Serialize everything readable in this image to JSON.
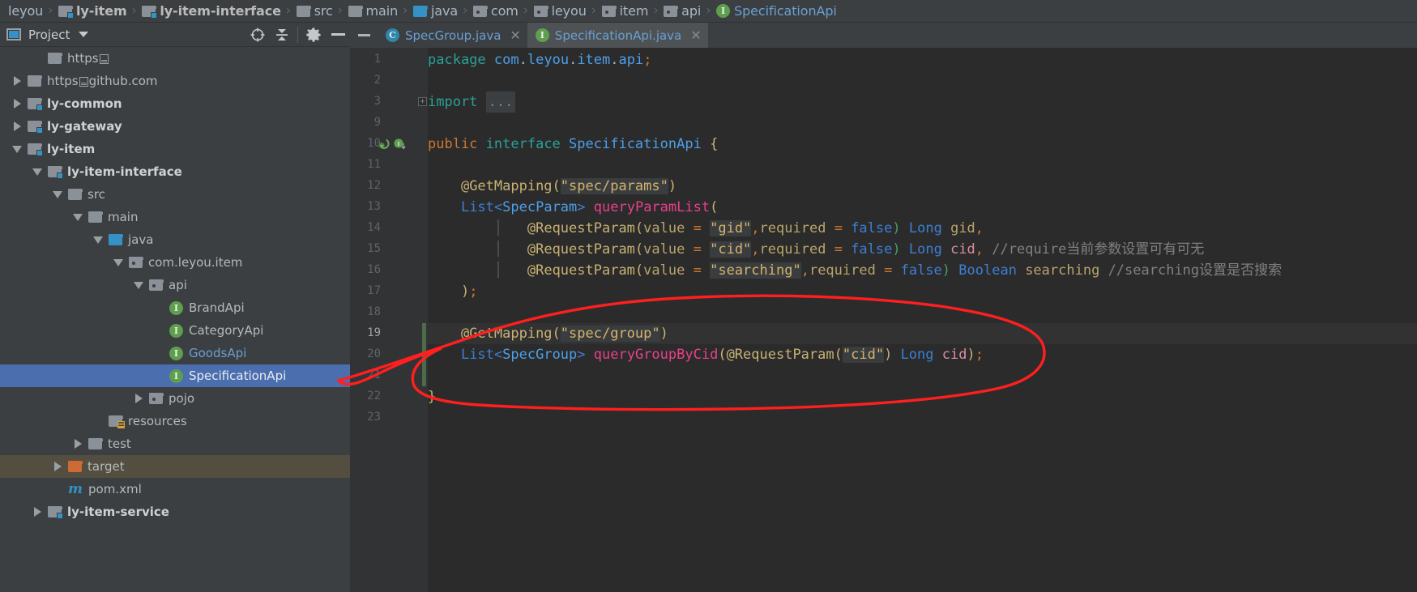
{
  "breadcrumb": {
    "items": [
      {
        "label": "leyou",
        "icon": "none",
        "style": "plain"
      },
      {
        "label": "ly-item",
        "icon": "module-folder-icon",
        "style": "bold"
      },
      {
        "label": "ly-item-interface",
        "icon": "module-folder-icon",
        "style": "bold"
      },
      {
        "label": "src",
        "icon": "folder-icon",
        "style": "plain"
      },
      {
        "label": "main",
        "icon": "folder-icon",
        "style": "plain"
      },
      {
        "label": "java",
        "icon": "source-folder-icon",
        "style": "plain"
      },
      {
        "label": "com",
        "icon": "package-icon",
        "style": "plain"
      },
      {
        "label": "leyou",
        "icon": "package-icon",
        "style": "plain"
      },
      {
        "label": "item",
        "icon": "package-icon",
        "style": "plain"
      },
      {
        "label": "api",
        "icon": "package-icon",
        "style": "plain"
      },
      {
        "label": "SpecificationApi",
        "icon": "interface-icon",
        "style": "blue"
      }
    ]
  },
  "tool_window": {
    "title": "Project",
    "icon": "project-window-icon",
    "dropdown_icon": "chevron-down-icon",
    "actions": [
      {
        "name": "scroll-from-source-icon",
        "tooltip": "Select Opened File"
      },
      {
        "name": "collapse-all-icon",
        "tooltip": "Collapse All"
      },
      {
        "name": "gear-icon",
        "tooltip": "Settings"
      },
      {
        "name": "hide-icon",
        "tooltip": "Hide"
      }
    ]
  },
  "project_tree": [
    {
      "label": "https▤",
      "indent": 1,
      "toggle": "none",
      "icon": "folder-icon",
      "style": "plain"
    },
    {
      "label": "https▤github.com",
      "indent": 0,
      "toggle": "collapsed",
      "icon": "folder-icon",
      "style": "plain"
    },
    {
      "label": "ly-common",
      "indent": 0,
      "toggle": "collapsed",
      "icon": "module-folder-icon",
      "style": "bold"
    },
    {
      "label": "ly-gateway",
      "indent": 0,
      "toggle": "collapsed",
      "icon": "module-folder-icon",
      "style": "bold"
    },
    {
      "label": "ly-item",
      "indent": 0,
      "toggle": "expanded",
      "icon": "module-folder-icon",
      "style": "bold"
    },
    {
      "label": "ly-item-interface",
      "indent": 1,
      "toggle": "expanded",
      "icon": "module-folder-icon",
      "style": "bold"
    },
    {
      "label": "src",
      "indent": 2,
      "toggle": "expanded",
      "icon": "folder-icon",
      "style": "plain"
    },
    {
      "label": "main",
      "indent": 3,
      "toggle": "expanded",
      "icon": "folder-icon",
      "style": "plain"
    },
    {
      "label": "java",
      "indent": 4,
      "toggle": "expanded",
      "icon": "source-folder-icon",
      "style": "plain"
    },
    {
      "label": "com.leyou.item",
      "indent": 5,
      "toggle": "expanded",
      "icon": "package-icon",
      "style": "plain"
    },
    {
      "label": "api",
      "indent": 6,
      "toggle": "expanded",
      "icon": "package-icon",
      "style": "plain"
    },
    {
      "label": "BrandApi",
      "indent": 7,
      "toggle": "none",
      "icon": "interface-icon",
      "style": "plain"
    },
    {
      "label": "CategoryApi",
      "indent": 7,
      "toggle": "none",
      "icon": "interface-icon",
      "style": "plain"
    },
    {
      "label": "GoodsApi",
      "indent": 7,
      "toggle": "none",
      "icon": "interface-icon",
      "style": "blue"
    },
    {
      "label": "SpecificationApi",
      "indent": 7,
      "toggle": "none",
      "icon": "interface-icon",
      "style": "selected"
    },
    {
      "label": "pojo",
      "indent": 6,
      "toggle": "collapsed",
      "icon": "package-icon",
      "style": "plain"
    },
    {
      "label": "resources",
      "indent": 4,
      "toggle": "none",
      "icon": "resources-folder-icon",
      "style": "plain"
    },
    {
      "label": "test",
      "indent": 3,
      "toggle": "collapsed",
      "icon": "folder-icon",
      "style": "plain"
    },
    {
      "label": "target",
      "indent": 2,
      "toggle": "collapsed",
      "icon": "excluded-folder-icon",
      "style": "excluded"
    },
    {
      "label": "pom.xml",
      "indent": 2,
      "toggle": "none",
      "icon": "maven-icon",
      "style": "plain"
    },
    {
      "label": "ly-item-service",
      "indent": 1,
      "toggle": "collapsed",
      "icon": "module-folder-icon",
      "style": "bold"
    }
  ],
  "editor_tabs": [
    {
      "label": "SpecGroup.java",
      "icon": "class-icon",
      "active": false,
      "close_icon": "close-icon"
    },
    {
      "label": "SpecificationApi.java",
      "icon": "interface-icon",
      "active": true,
      "close_icon": "close-icon"
    }
  ],
  "editor": {
    "file": "SpecificationApi.java",
    "line_numbers": [
      "1",
      "2",
      "3",
      "9",
      "10",
      "11",
      "12",
      "13",
      "14",
      "15",
      "16",
      "17",
      "18",
      "19",
      "20",
      "21",
      "22",
      "23"
    ],
    "current_line": "19",
    "fold_marker": "+",
    "gutter_icons": [
      "spring-bean-icon",
      "interface-implemented-icon"
    ],
    "lines": [
      "package com.leyou.item.api;",
      "",
      "import ...",
      "",
      "public interface SpecificationApi {",
      "",
      "    @GetMapping(\"spec/params\")",
      "    List<SpecParam> queryParamList(",
      "            @RequestParam(value = \"gid\",required = false) Long gid,",
      "            @RequestParam(value = \"cid\",required = false) Long cid, //require当前参数设置可有可无",
      "            @RequestParam(value = \"searching\",required = false) Boolean searching //searching设置是否搜索",
      "    );",
      "",
      "    @GetMapping(\"spec/group\")",
      "    List<SpecGroup> queryGroupByCid(@RequestParam(\"cid\") Long cid);",
      "",
      "}",
      ""
    ],
    "comments": [
      "//require当前参数设置可有可无",
      "//searching设置是否搜索"
    ],
    "strings": [
      "spec/params",
      "gid",
      "cid",
      "searching",
      "spec/group",
      "cid"
    ]
  },
  "annotation": {
    "type": "hand-drawn-ellipse",
    "color": "#ff1f1f",
    "encircles": "lines 19-22 queryGroupByCid declaration"
  },
  "colors": {
    "editor_bg": "#2b2b2b",
    "panel_bg": "#3c3f41",
    "gutter_bg": "#313335",
    "selection_blue": "#4b6eaf",
    "excluded_olive": "#534e3f",
    "tab_active": "#4e5254",
    "link_blue": "#6a9fd4",
    "annotation_red": "#ff1f1f"
  }
}
